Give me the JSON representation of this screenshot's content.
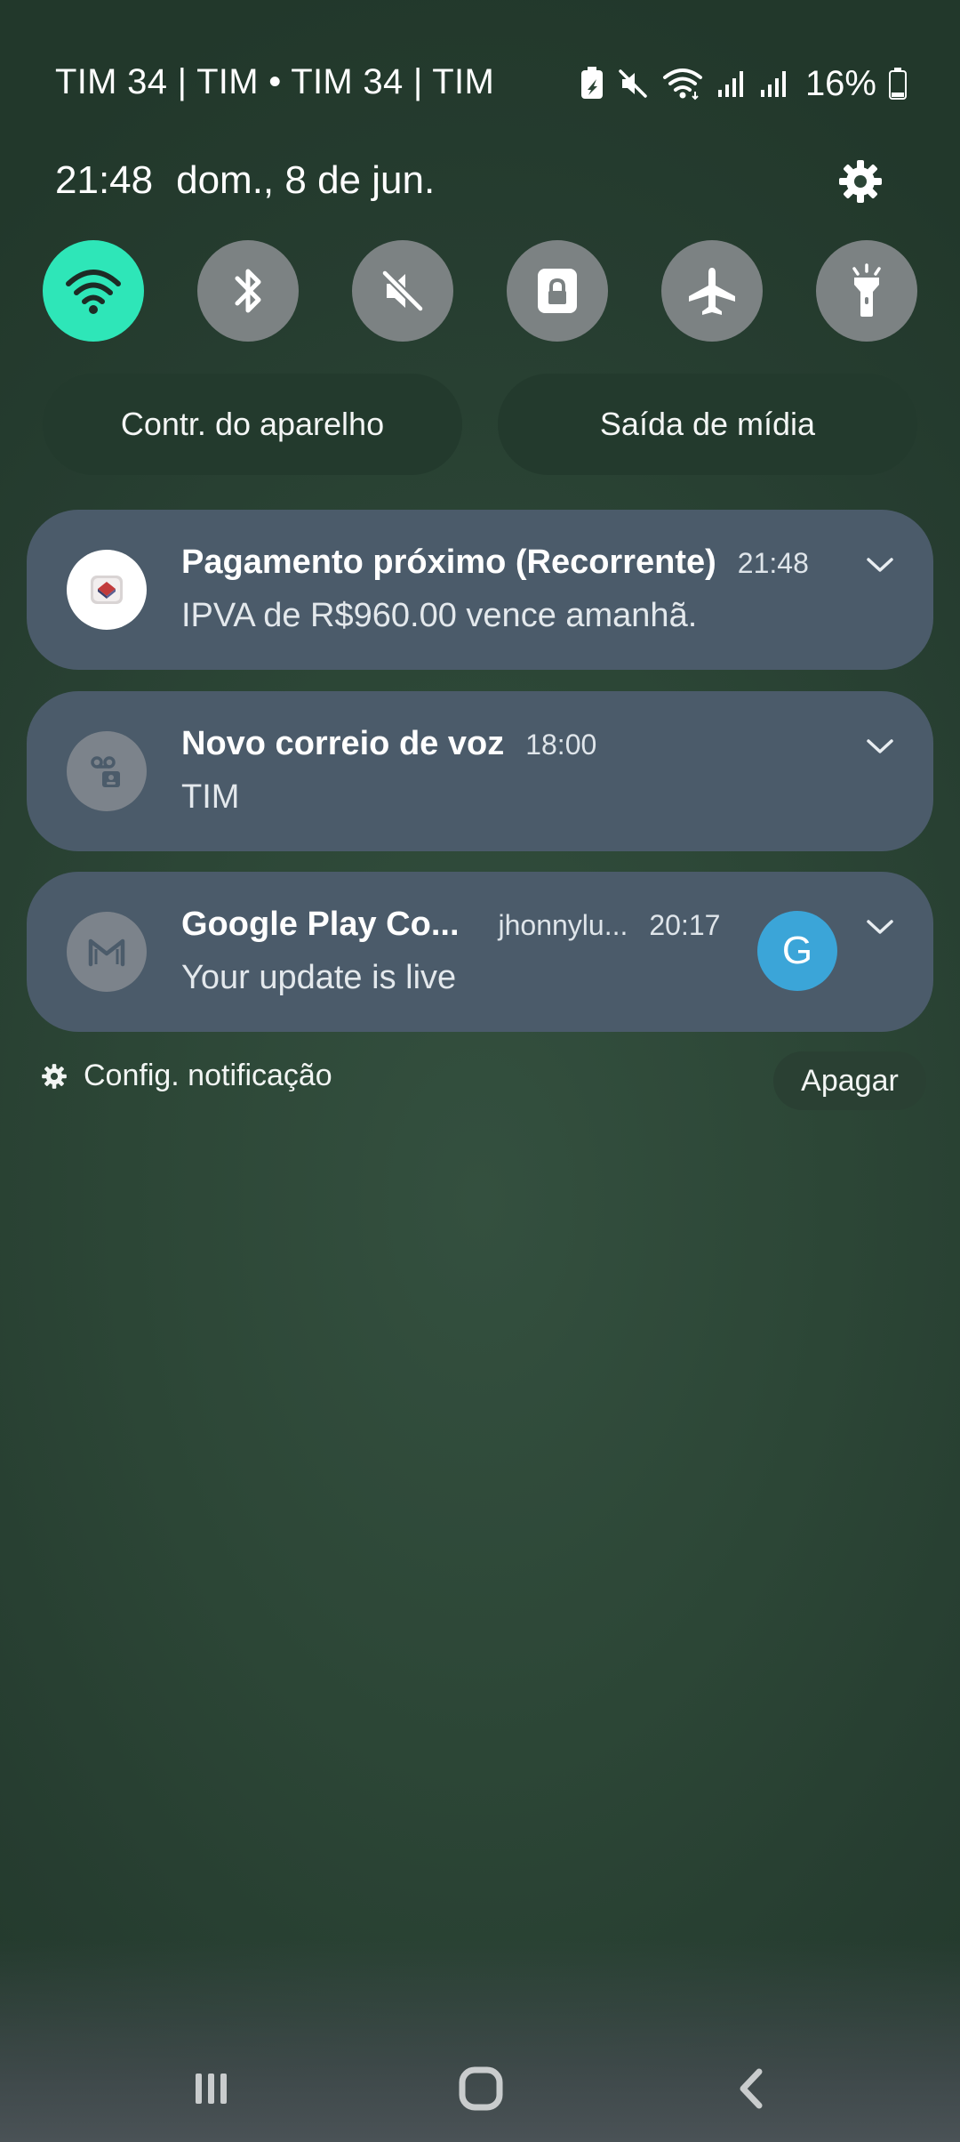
{
  "status_bar": {
    "carrier": "TIM 34 | TIM • TIM 34 | TIM",
    "battery": "16%",
    "icons": [
      "battery-saver-icon",
      "mute-icon",
      "wifi-icon",
      "signal-sim1-icon",
      "signal-sim2-icon",
      "battery-icon"
    ]
  },
  "header": {
    "time": "21:48",
    "date": "dom., 8 de jun.",
    "settings_icon": "gear-icon"
  },
  "quick_toggles": [
    {
      "name": "wifi",
      "icon": "wifi-icon",
      "on": true
    },
    {
      "name": "bluetooth",
      "icon": "bluetooth-icon",
      "on": false
    },
    {
      "name": "sound",
      "icon": "mute-icon",
      "on": false
    },
    {
      "name": "rotation-lock",
      "icon": "lock-icon",
      "on": false
    },
    {
      "name": "airplane",
      "icon": "airplane-icon",
      "on": false
    },
    {
      "name": "flashlight",
      "icon": "flashlight-icon",
      "on": false
    }
  ],
  "pills": {
    "device_control": "Contr. do aparelho",
    "media_output": "Saída de mídia"
  },
  "notifications": [
    {
      "app_icon": "payment-app-icon",
      "title": "Pagamento próximo (Recorrente)",
      "time": "21:48",
      "body": "IPVA de R$960.00 vence amanhã."
    },
    {
      "app_icon": "voicemail-icon",
      "title": "Novo correio de voz",
      "time": "18:00",
      "body": "TIM"
    },
    {
      "app_icon": "gmail-icon",
      "title": "Google Play Co...",
      "account": "jhonnylu...",
      "time": "20:17",
      "body": "Your update is live",
      "avatar_letter": "G"
    }
  ],
  "footer": {
    "notif_settings": "Config. notificação",
    "clear": "Apagar"
  },
  "navbar": {
    "recents": "recents-icon",
    "home": "home-icon",
    "back": "back-icon"
  },
  "colors": {
    "toggle_on": "#2ee6b8",
    "toggle_off": "#7c8283",
    "notification_bg": "#4b5b6a",
    "avatar": "#3ba5d8"
  }
}
